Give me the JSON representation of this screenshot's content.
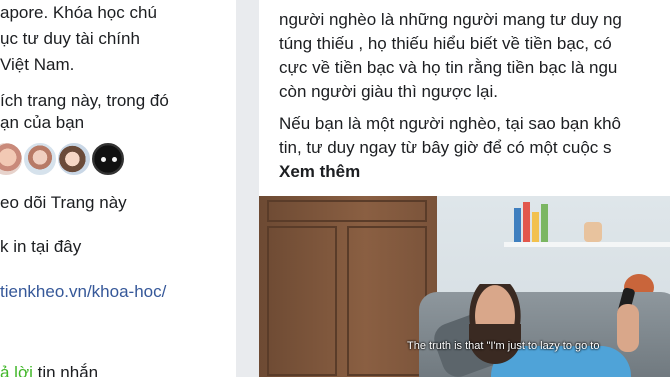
{
  "page_info": {
    "lines": [
      "apore. Khóa học chú",
      "ục tư duy tài chính",
      "Việt Nam."
    ],
    "likes_text_1": "ích trang này, trong đó",
    "likes_text_2": "ạn của bạn",
    "follows_text": "eo dõi Trang này",
    "checkin_text": "k in tại đây",
    "website_link": "tienkheo.vn/khoa-hoc/",
    "reply_prefix": "ả lời",
    "reply_rest": " tin nhắn"
  },
  "post": {
    "lines": [
      "người nghèo là những người mang tư duy ng",
      "túng thiếu , họ thiếu hiểu biết về tiền bạc, có",
      "cực về tiền bạc và họ tin rằng tiền bạc là ngu",
      "còn người giàu thì ngược lại.",
      "Nếu bạn là một người nghèo, tại sao bạn khô",
      "tin, tư duy ngay từ bây giờ để có một cuộc s"
    ],
    "see_more": "Xem thêm",
    "video_subtitle": "The truth is that \"I'm just to lazy to go to"
  },
  "colors": {
    "background": "#e9ebee",
    "link": "#365899",
    "green": "#42b72a",
    "text": "#1c1e21"
  }
}
